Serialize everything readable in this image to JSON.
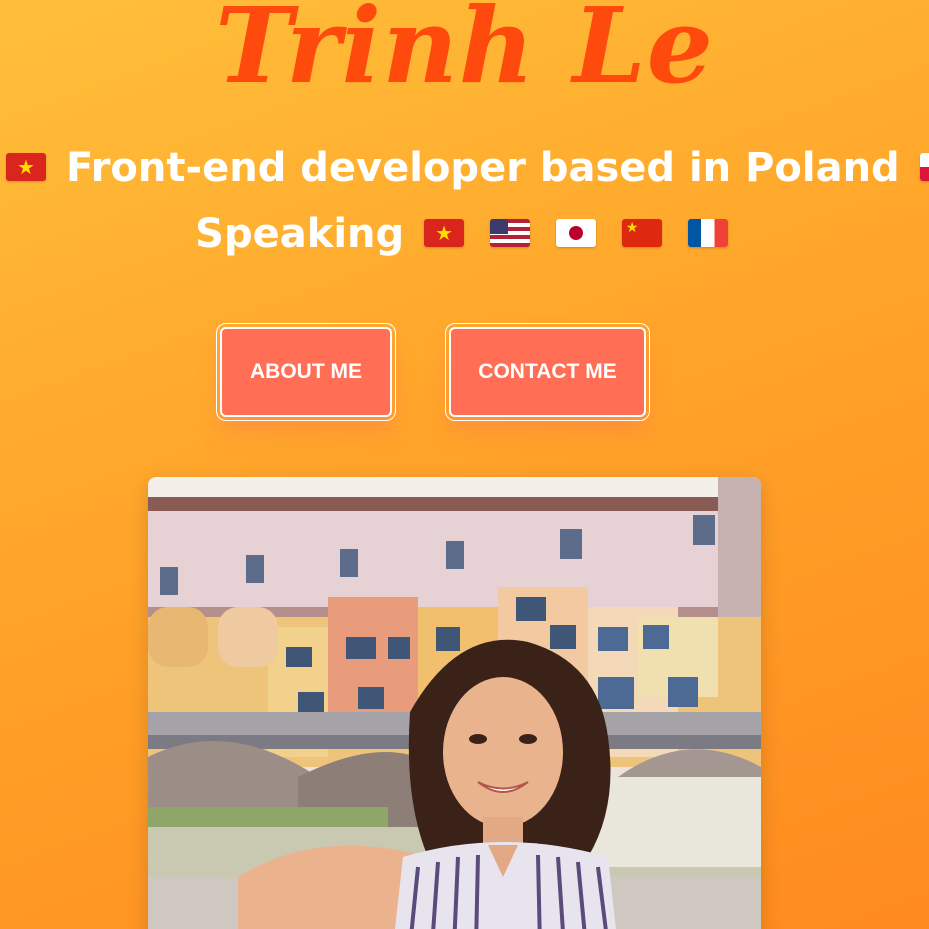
{
  "header": {
    "name": "Trinh Le",
    "tagline": "Front-end developer based in Poland",
    "speaking_label": "Speaking"
  },
  "flags": {
    "tagline_left": "vietnam-flag-icon",
    "tagline_right": "poland-flag-icon",
    "languages": [
      "vietnam-flag-icon",
      "usa-flag-icon",
      "japan-flag-icon",
      "china-flag-icon",
      "france-flag-icon"
    ]
  },
  "buttons": {
    "about": "ABOUT ME",
    "contact": "CONTACT ME"
  },
  "colors": {
    "title": "#ff4a0e",
    "button_bg": "#ff6e55",
    "background_start": "#ffbf3a",
    "background_end": "#ff8a1e"
  }
}
